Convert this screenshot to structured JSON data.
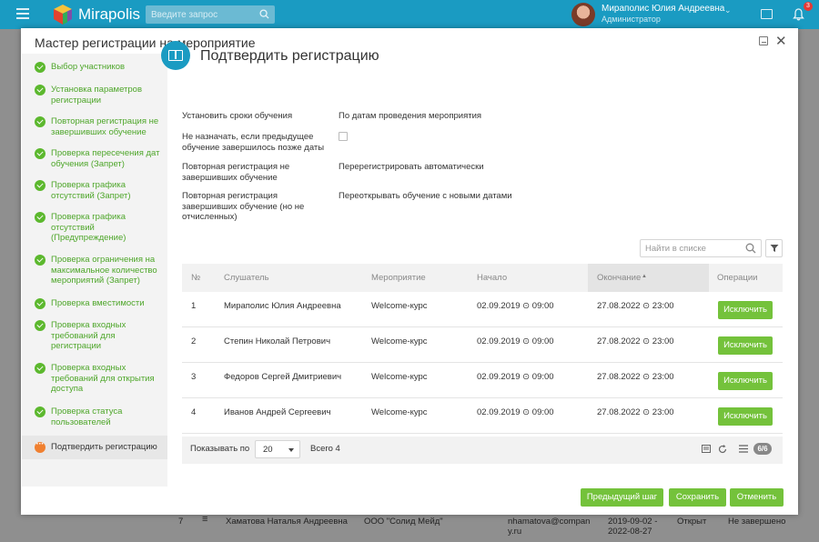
{
  "app": {
    "logo": "Mirapolis",
    "search_placeholder": "Введите запрос",
    "user_name": "Мираполис Юлия Андреевна",
    "user_role": "Администратор",
    "notifications_count": "3"
  },
  "background_row": {
    "index": "7",
    "name": "Хаматова Наталья Андреевна",
    "company": "ООО \"Солид Мейд\"",
    "email": "nhamatova@company.ru",
    "email_line1": "nhamatova@compan",
    "email_line2": "y.ru",
    "dates_line1": "2019-09-02 -",
    "dates_line2": "2022-08-27",
    "status": "Открыт",
    "completion": "Не завершено"
  },
  "modal": {
    "title": "Мастер регистрации на мероприятие"
  },
  "steps": [
    {
      "label": "Выбор участников"
    },
    {
      "label": "Установка параметров регистрации"
    },
    {
      "label": "Повторная регистрация не завершивших обучение"
    },
    {
      "label": "Проверка пересечения дат обучения (Запрет)"
    },
    {
      "label": "Проверка графика отсутствий (Запрет)"
    },
    {
      "label": "Проверка графика отсутствий (Предупреждение)"
    },
    {
      "label": "Проверка ограничения на максимальное количество мероприятий (Запрет)"
    },
    {
      "label": "Проверка вместимости"
    },
    {
      "label": "Проверка входных требований для регистрации"
    },
    {
      "label": "Проверка входных требований для открытия доступа"
    },
    {
      "label": "Проверка статуса пользователей"
    },
    {
      "label": "Подтвердить регистрацию"
    }
  ],
  "page": {
    "title": "Подтвердить регистрацию"
  },
  "fields": {
    "f1_label": "Установить сроки обучения",
    "f1_value": "По датам проведения мероприятия",
    "f2_label": "Не назначать, если предыдущее обучение завершилось позже даты",
    "f2_checked": false,
    "f3_label": "Повторная регистрация не завершивших обучение",
    "f3_value": "Перерегистрировать автоматически",
    "f4_label": "Повторная регистрация завершивших обучение (но не отчисленных)",
    "f4_value": "Переоткрывать обучение с новыми датами"
  },
  "list": {
    "search_placeholder": "Найти в списке",
    "columns": {
      "num": "№",
      "listener": "Слушатель",
      "event": "Мероприятие",
      "start": "Начало",
      "end": "Окончание",
      "ops": "Операции"
    },
    "sort_indicator": "▲",
    "rows": [
      {
        "num": "1",
        "name": "Мираполис Юлия Андреевна",
        "event": "Welcome-курс",
        "start": "02.09.2019 ⊙ 09:00",
        "end": "27.08.2022 ⊙ 23:00",
        "action": "Исключить"
      },
      {
        "num": "2",
        "name": "Степин Николай Петрович",
        "event": "Welcome-курс",
        "start": "02.09.2019 ⊙ 09:00",
        "end": "27.08.2022 ⊙ 23:00",
        "action": "Исключить"
      },
      {
        "num": "3",
        "name": "Федоров Сергей Дмитриевич",
        "event": "Welcome-курс",
        "start": "02.09.2019 ⊙ 09:00",
        "end": "27.08.2022 ⊙ 23:00",
        "action": "Исключить"
      },
      {
        "num": "4",
        "name": "Иванов Андрей Сергеевич",
        "event": "Welcome-курс",
        "start": "02.09.2019 ⊙ 09:00",
        "end": "27.08.2022 ⊙ 23:00",
        "action": "Исключить"
      }
    ],
    "footer": {
      "show_by": "Показывать по",
      "page_size": "20",
      "total": "Всего 4",
      "columns_badge": "6/6"
    }
  },
  "buttons": {
    "prev": "Предыдущий шаг",
    "save": "Сохранить",
    "cancel": "Отменить"
  },
  "colors": {
    "header": "#1a9bc2",
    "accent_green": "#74c23b",
    "step_done": "#5cb82e",
    "step_active": "#f08030"
  }
}
